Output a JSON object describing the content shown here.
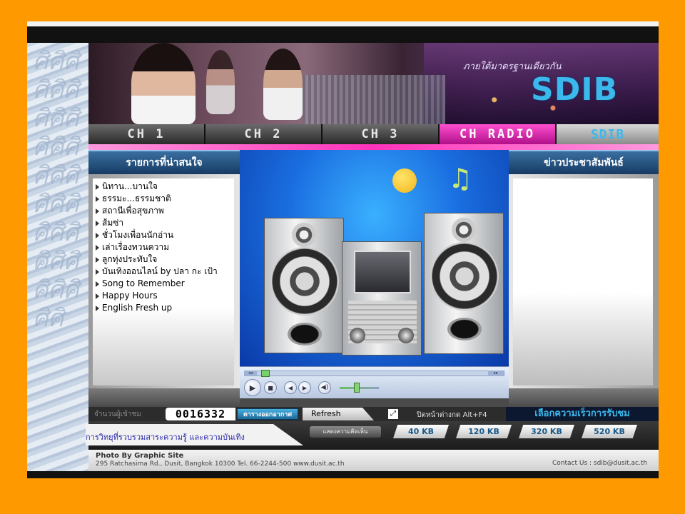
{
  "banner": {
    "slogan": "ภายใต้มาตรฐานเดียวกัน",
    "logo_text": "SDIB"
  },
  "nav": {
    "items": [
      {
        "label": "CH 1"
      },
      {
        "label": "CH 2"
      },
      {
        "label": "CH 3"
      },
      {
        "label": "CH RADIO"
      },
      {
        "label": "SDIB"
      }
    ]
  },
  "left_panel": {
    "title": "รายการที่น่าสนใจ",
    "items": [
      "นิทาน...บานใจ",
      "ธรรมะ...ธรรมชาติ",
      "สถานีเพื่อสุขภาพ",
      "ส้มซ่า",
      "ชั่วโมงเพื่อนนักอ่าน",
      "เล่าเรื่องทวนความ",
      "ลูกทุ่งประทับใจ",
      "บันเทิงออนไลน์ by ปลา กะ เป้า",
      "Song to Remember",
      "Happy Hours",
      "English Fresh up"
    ]
  },
  "right_panel": {
    "title": "ข่าวประชาสัมพันธ์"
  },
  "player": {
    "rewind_label": "◂◂",
    "forward_label": "▸▸",
    "play_icon": "▶",
    "stop_icon": "■",
    "prev_icon": "◀",
    "next_icon": "▶",
    "volume_icon": "◀)",
    "note_glyph": "♫"
  },
  "bottom_bar": {
    "visitor_label": "จำนวนผู้เข้าชม",
    "counter": "0016332",
    "schedule_label": "ตารางออกอากาศ",
    "refresh_label": "Refresh",
    "fullscreen_icon": "⤢",
    "fullscreen_label": "ปิดหน้าต่างกด Alt+F4",
    "speed_label": "เลือกความเร็วการรับชม"
  },
  "speed_bar": {
    "tagline": "การวิทยุที่รวบรวมสาระความรู้ และความบันเทิง",
    "show_comments": "แสดงความคิดเห็น",
    "speeds": [
      "40 KB",
      "120 KB",
      "320 KB",
      "520 KB"
    ]
  },
  "footer": {
    "photo_credit": "Photo By Graphic Site",
    "address": "295  Ratchasima Rd., Dusit, Bangkok 10300 Tel. 66-2244-500 www.dusit.ac.th",
    "contact": "Contact Us : sdib@dusit.ac.th"
  },
  "colors": {
    "page_background": "#ff9900",
    "accent_pink": "#ff33bb",
    "accent_blue": "#3bb8ec"
  }
}
